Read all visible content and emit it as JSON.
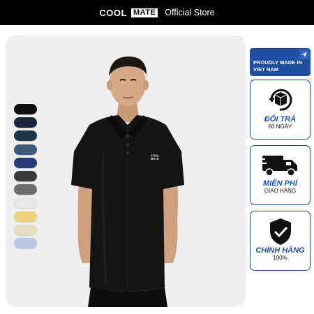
{
  "header": {
    "brand_part1": "COOL",
    "brand_part2": "MATE",
    "store_label": "Official Store"
  },
  "swatches": {
    "colors": [
      "#101010",
      "#1a2540",
      "#1f3346",
      "#3e5a7a",
      "#283a78",
      "#3a3a3a",
      "#6b6c6e",
      "#e7e7e7",
      "#efd37a",
      "#e6dcc3",
      "#b8c8e4"
    ]
  },
  "badges": {
    "made_in": "PROUDLY MADE IN VIET NAM",
    "return": {
      "title": "ĐỔI TRẢ",
      "subtitle": "60 NGÀY"
    },
    "shipping": {
      "title": "MIỄN PHÍ",
      "subtitle": "GIAO HÀNG"
    },
    "authentic": {
      "title": "CHÍNH HÃNG",
      "subtitle": "100%"
    }
  },
  "logo_on_shirt": "COOL MATE",
  "colors": {
    "accent": "#1f4ea3",
    "header_bg": "#000000",
    "card_bg": "#efefef"
  }
}
